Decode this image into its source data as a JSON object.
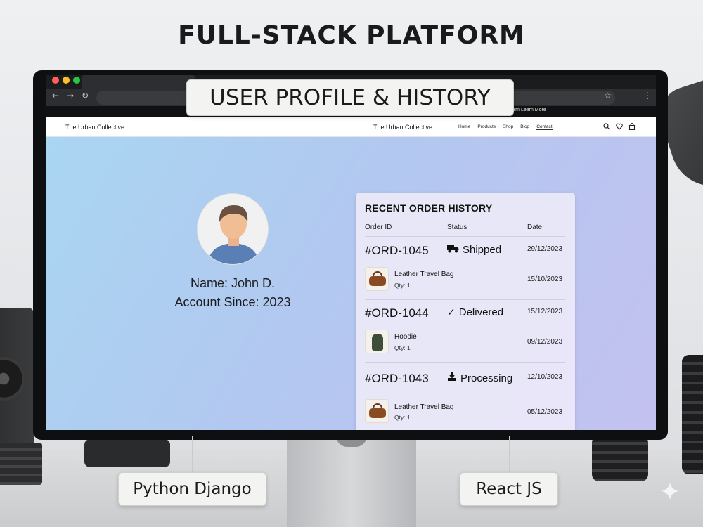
{
  "main_title": "FULL-STACK PLATFORM",
  "overlay_title": "USER PROFILE & HISTORY",
  "browser": {
    "info_text": "form ",
    "info_link": "Learn More"
  },
  "site": {
    "brand_left": "The Urban Collective",
    "brand_center": "The Urban Collective",
    "nav": [
      "Home",
      "Products",
      "Shop",
      "Blog",
      "Contact"
    ],
    "active_nav": "Contact",
    "icons": [
      "search-icon",
      "heart-icon",
      "cart-icon"
    ]
  },
  "profile": {
    "name": "Name: John D.",
    "account_since": "Account Since: 2023"
  },
  "orders": {
    "title": "RECENT ORDER HISTORY",
    "columns": [
      "Order ID",
      "Status",
      "Date"
    ],
    "list": [
      {
        "id": "#ORD-1045",
        "status": "Shipped",
        "status_icon": "truck-icon",
        "date": "29/12/2023",
        "item": {
          "name": "Leather Travel Bag",
          "qty": "Qty: 1",
          "date": "15/10/2023",
          "thumb": "bag"
        }
      },
      {
        "id": "#ORD-1044",
        "status": "Delivered",
        "status_icon": "check-icon",
        "date": "15/12/2023",
        "item": {
          "name": "Hoodie",
          "qty": "Qty: 1",
          "date": "09/12/2023",
          "thumb": "hoodie"
        }
      },
      {
        "id": "#ORD-1043",
        "status": "Processing",
        "status_icon": "processing-icon",
        "date": "12/10/2023",
        "item": {
          "name": "Leather Travel Bag",
          "qty": "Qty: 1",
          "date": "05/12/2023",
          "thumb": "bag"
        }
      }
    ]
  },
  "tech_labels": {
    "backend": "Python Django",
    "frontend": "React JS"
  },
  "colors": {
    "page_gradient_start": "#a9d6f2",
    "page_gradient_end": "#c3c1f0",
    "card_bg": "#ebe9f8",
    "window_dot_red": "#ff5f57",
    "window_dot_yellow": "#febc2e",
    "window_dot_green": "#28c840"
  }
}
